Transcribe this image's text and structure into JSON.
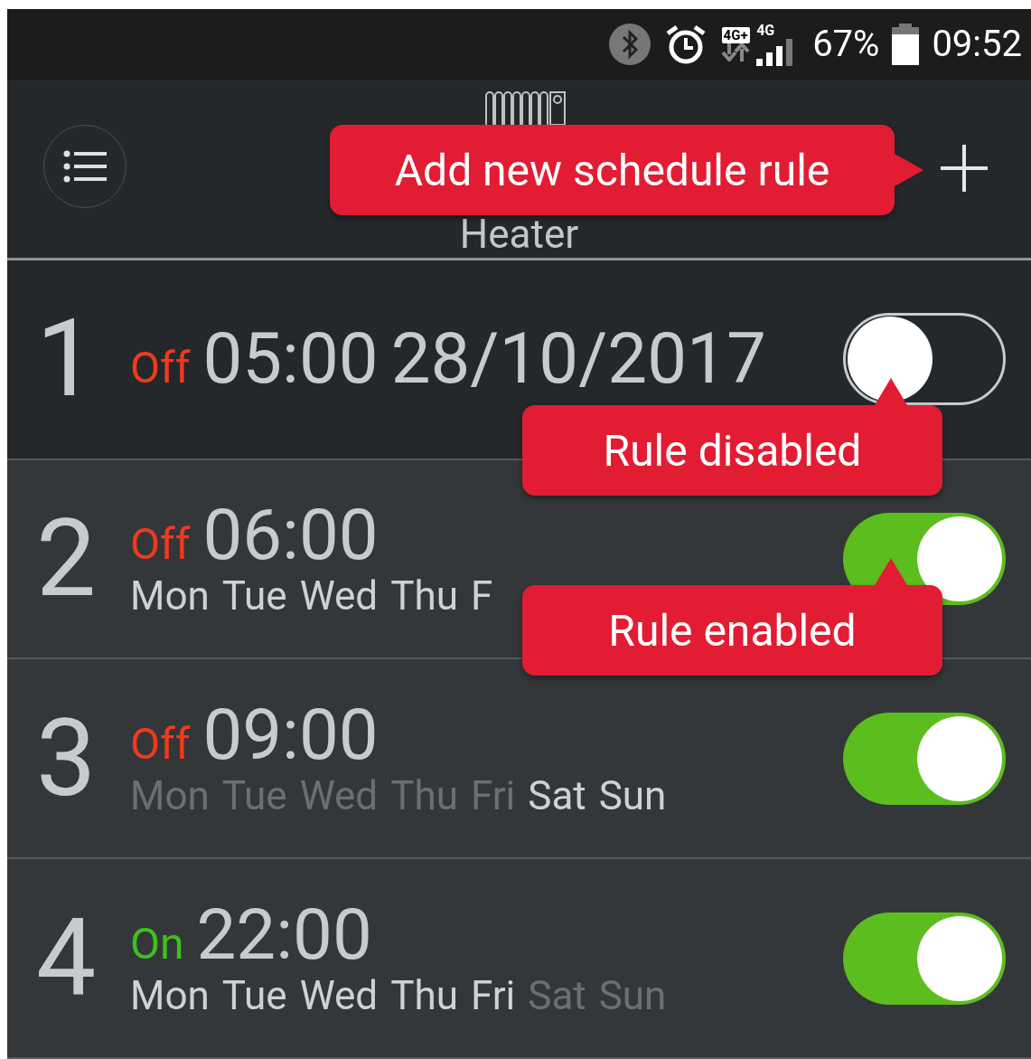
{
  "status_bar": {
    "battery": "67%",
    "time": "09:52",
    "network": "4G+",
    "network_2": "4G"
  },
  "header": {
    "title": "Heater"
  },
  "rules": [
    {
      "number": "1",
      "state": "Off",
      "state_on": false,
      "time": "05:00",
      "date": "28/10/2017",
      "enabled": false
    },
    {
      "number": "2",
      "state": "Off",
      "state_on": false,
      "time": "06:00",
      "enabled": true,
      "days": [
        {
          "label": "Mon",
          "active": true
        },
        {
          "label": "Tue",
          "active": true
        },
        {
          "label": "Wed",
          "active": true
        },
        {
          "label": "Thu",
          "active": true
        },
        {
          "label": "F",
          "active": true
        }
      ]
    },
    {
      "number": "3",
      "state": "Off",
      "state_on": false,
      "time": "09:00",
      "enabled": true,
      "days": [
        {
          "label": "Mon",
          "active": false
        },
        {
          "label": "Tue",
          "active": false
        },
        {
          "label": "Wed",
          "active": false
        },
        {
          "label": "Thu",
          "active": false
        },
        {
          "label": "Fri",
          "active": false
        },
        {
          "label": "Sat",
          "active": true
        },
        {
          "label": "Sun",
          "active": true
        }
      ]
    },
    {
      "number": "4",
      "state": "On",
      "state_on": true,
      "time": "22:00",
      "enabled": true,
      "days": [
        {
          "label": "Mon",
          "active": true
        },
        {
          "label": "Tue",
          "active": true
        },
        {
          "label": "Wed",
          "active": true
        },
        {
          "label": "Thu",
          "active": true
        },
        {
          "label": "Fri",
          "active": true
        },
        {
          "label": "Sat",
          "active": false
        },
        {
          "label": "Sun",
          "active": false
        }
      ]
    }
  ],
  "callouts": [
    {
      "text": "Add new schedule rule",
      "kind": "right"
    },
    {
      "text": "Rule disabled",
      "kind": "up"
    },
    {
      "text": "Rule enabled",
      "kind": "up"
    }
  ]
}
